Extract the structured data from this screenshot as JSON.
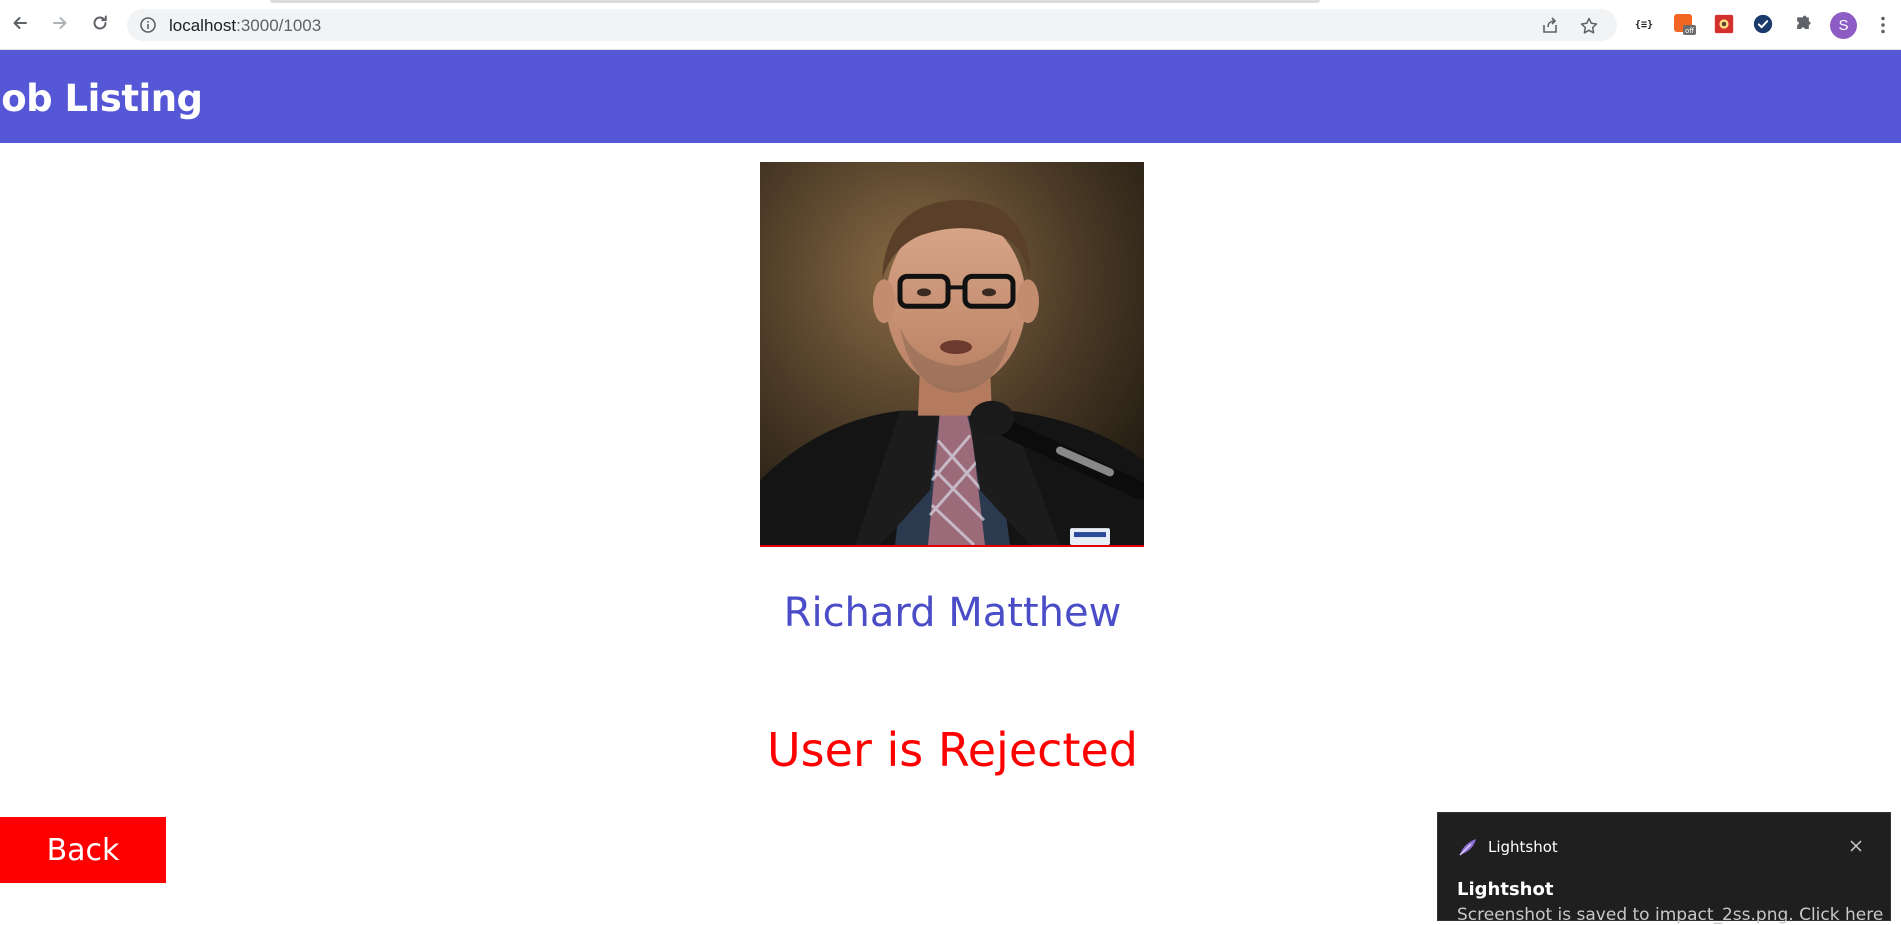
{
  "browser": {
    "url_host": "localhost",
    "url_path": ":3000/1003",
    "profile_initial": "S",
    "extension_badge": "off"
  },
  "header": {
    "title": "Job Listing"
  },
  "profile": {
    "name": "Richard Matthew",
    "status": "User is Rejected"
  },
  "actions": {
    "back_label": "Back"
  },
  "toast": {
    "app_name": "Lightshot",
    "title": "Lightshot",
    "body": "Screenshot is saved to impact_2ss.png. Click here"
  },
  "colors": {
    "header_bg": "#5557d6",
    "name_color": "#4b4dc8",
    "status_color": "#ff0000",
    "back_bg": "#ff0000"
  }
}
